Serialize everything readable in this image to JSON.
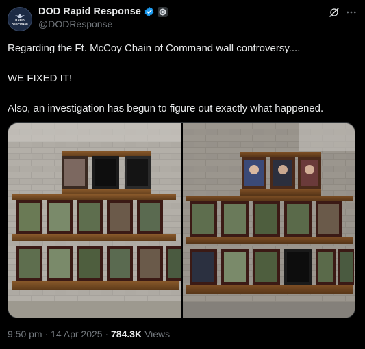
{
  "account": {
    "display_name": "DOD Rapid Response",
    "handle": "@DODResponse",
    "avatar_text_line1": "RAPID",
    "avatar_text_line2": "RESPONSE",
    "verified_color": "#1d9bf0"
  },
  "tweet": {
    "line1": "Regarding the Ft. McCoy Chain of Command wall controversy....",
    "line2": "WE FIXED IT!",
    "line3": "Also, an investigation has begun to figure out exactly what happened."
  },
  "media": {
    "photos": [
      {
        "state": "before",
        "top_row_frames": "empty",
        "filled_portraits_lower_row": 6
      },
      {
        "state": "after",
        "top_row_frames": "filled",
        "filled_portraits_lower_row": 5
      }
    ]
  },
  "meta": {
    "time": "9:50 pm",
    "separator": "·",
    "date": "14 Apr 2025",
    "views_count": "784.3K",
    "views_label": "Views"
  }
}
